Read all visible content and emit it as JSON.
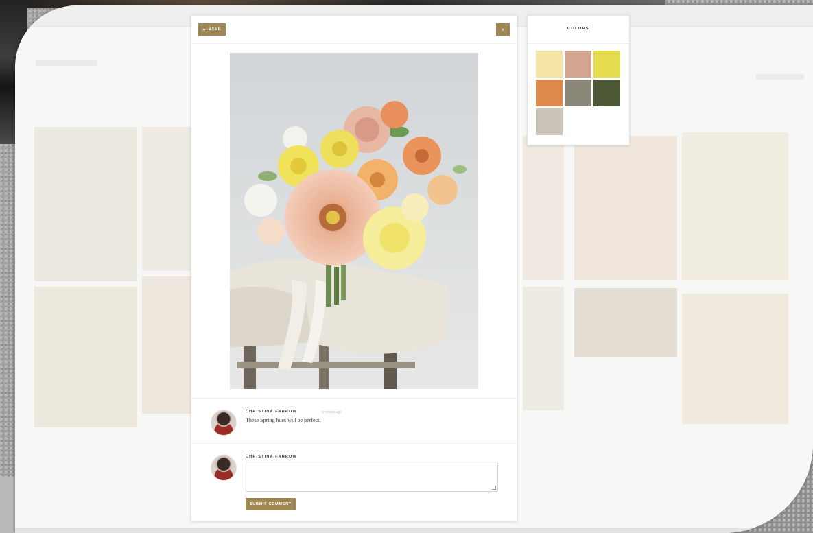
{
  "modal": {
    "save_label": "SAVE",
    "save_icon": "plus-icon",
    "close_label": "×",
    "photo": {
      "subject": "bouquet-image"
    }
  },
  "comments": [
    {
      "author": "CHRISTINA FARROW",
      "time": "a minute ago",
      "text": "These Spring hues will be perfect!"
    }
  ],
  "comment_form": {
    "author": "CHRISTINA FARROW",
    "textarea_value": "",
    "submit_label": "SUBMIT COMMENT"
  },
  "colors": {
    "title": "COLORS",
    "swatches": [
      "#f4e4a6",
      "#d3a590",
      "#e6dc50",
      "#dd8a4c",
      "#8a8678",
      "#4d5837",
      "#cac5b8"
    ]
  },
  "theme": {
    "accent": "#9f8754"
  }
}
